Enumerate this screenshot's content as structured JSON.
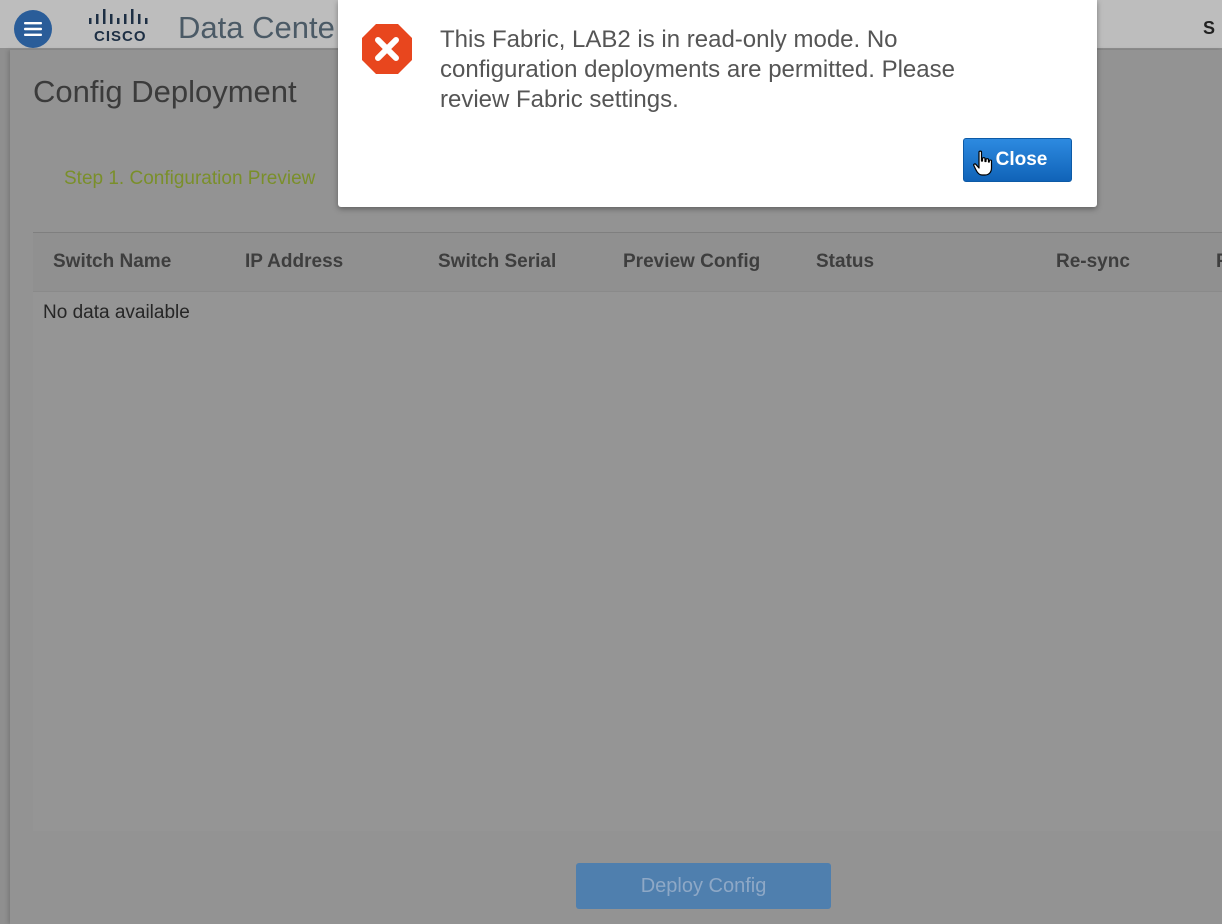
{
  "header": {
    "logo_text": "CISCO",
    "app_title": "Data Cente",
    "right_letter": "S"
  },
  "page": {
    "title": "Config Deployment",
    "step_label": "Step 1. Configuration Preview"
  },
  "table": {
    "columns": [
      "Switch Name",
      "IP Address",
      "Switch Serial",
      "Preview Config",
      "Status",
      "Re-sync",
      "F"
    ],
    "empty_message": "No data available"
  },
  "footer": {
    "deploy_label": "Deploy Config"
  },
  "modal": {
    "message": "This Fabric, LAB2 is in read-only mode. No configuration deployments are permitted. Please review Fabric settings.",
    "close_label": "Close"
  },
  "colors": {
    "error": "#e8461e",
    "primary": "#1b74cf",
    "step_text": "#7a8f2a"
  },
  "icons": {
    "menu": "hamburger-icon",
    "error": "error-x-icon",
    "cursor": "hand-pointer-icon"
  }
}
